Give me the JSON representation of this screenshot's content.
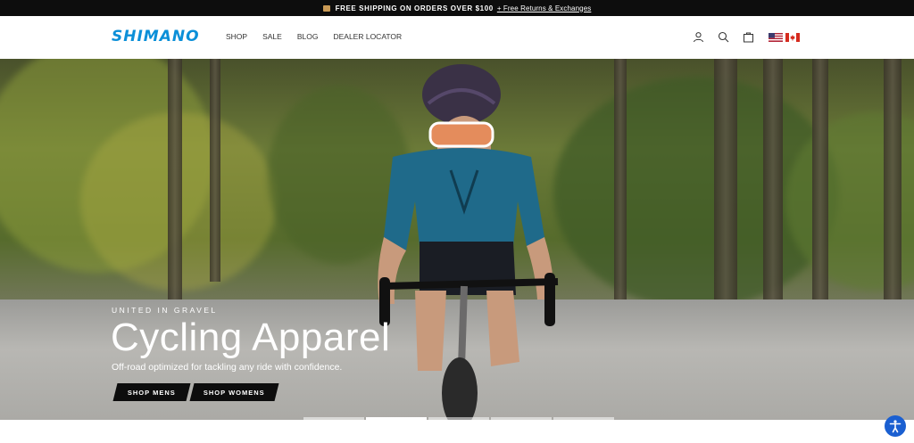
{
  "announcement": {
    "text": "FREE SHIPPING ON ORDERS OVER $100",
    "link": "+ Free Returns & Exchanges"
  },
  "header": {
    "logo": "SHIMANO",
    "nav": [
      "SHOP",
      "SALE",
      "BLOG",
      "DEALER LOCATOR"
    ],
    "icons": [
      "account-icon",
      "search-icon",
      "cart-icon"
    ],
    "flags": [
      "us-flag",
      "canada-flag"
    ]
  },
  "hero": {
    "eyebrow": "UNITED IN GRAVEL",
    "title": "Cycling Apparel",
    "subtitle": "Off-road optimized for tackling any ride with confidence.",
    "buttons": [
      "SHOP MENS",
      "SHOP WOMENS"
    ],
    "slides_total": 5,
    "active_slide": 2
  },
  "colors": {
    "brand": "#0b8fd8",
    "dark": "#0d0d0d",
    "accessibility": "#1a5fd1"
  }
}
